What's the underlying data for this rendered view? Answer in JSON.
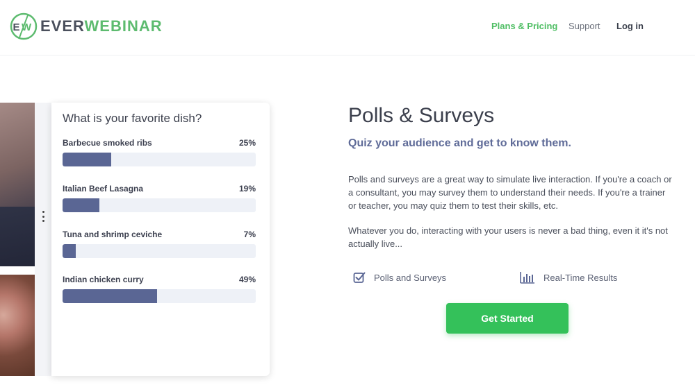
{
  "brand": {
    "ever": "EVER",
    "webinar": "WEBINAR",
    "colors": {
      "green": "#5dbb6f",
      "gray": "#4a4f5c"
    }
  },
  "nav": {
    "plans": "Plans & Pricing",
    "support": "Support",
    "login": "Log in"
  },
  "poll": {
    "question": "What is your favorite dish?",
    "options": [
      {
        "label": "Barbecue smoked ribs",
        "percent_label": "25%",
        "percent": 25
      },
      {
        "label": "Italian Beef Lasagna",
        "percent_label": "19%",
        "percent": 19
      },
      {
        "label": "Tuna and shrimp ceviche",
        "percent_label": "7%",
        "percent": 7
      },
      {
        "label": "Indian chicken curry",
        "percent_label": "49%",
        "percent": 49
      }
    ],
    "bar_color": "#5a6694"
  },
  "section": {
    "title": "Polls & Surveys",
    "subtitle": "Quiz your audience and get to know them.",
    "paragraph1": "Polls and surveys are a great way to simulate live interaction. If you're a coach or a consultant, you may survey them to understand their needs. If you're a trainer or teacher, you may quiz them to test their skills, etc.",
    "paragraph2": "Whatever you do, interacting with your users is never a bad thing, even it it's not actually live..."
  },
  "features": [
    {
      "label": "Polls and Surveys",
      "icon": "checkbox-icon"
    },
    {
      "label": "Real-Time Results",
      "icon": "bar-chart-icon"
    }
  ],
  "cta": {
    "label": "Get Started",
    "color": "#34c15a"
  }
}
